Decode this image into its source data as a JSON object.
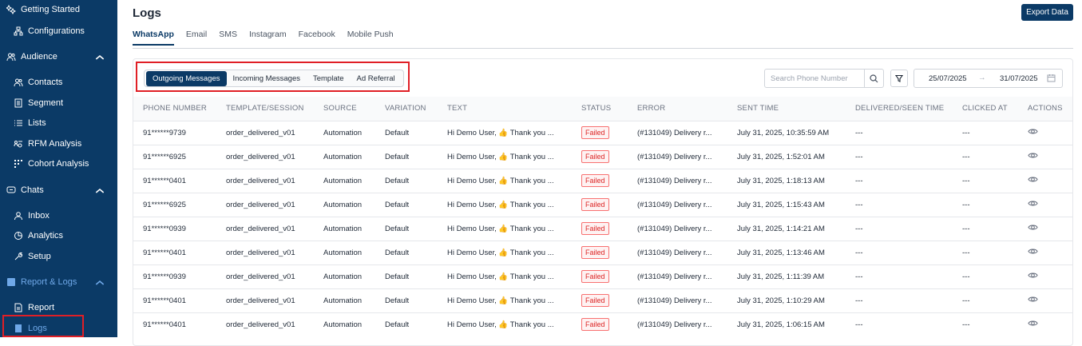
{
  "sidebar": {
    "items": [
      {
        "label": "Getting Started",
        "icon": "sparkle-icon",
        "type": "section"
      },
      {
        "label": "Configurations",
        "icon": "sitemap-icon",
        "type": "item"
      },
      {
        "label": "Audience",
        "icon": "users-icon",
        "type": "section"
      },
      {
        "label": "Contacts",
        "icon": "users-icon",
        "type": "item"
      },
      {
        "label": "Segment",
        "icon": "document-icon",
        "type": "item"
      },
      {
        "label": "Lists",
        "icon": "list-icon",
        "type": "item"
      },
      {
        "label": "RFM Analysis",
        "icon": "rfm-icon",
        "type": "item"
      },
      {
        "label": "Cohort Analysis",
        "icon": "grid-icon",
        "type": "item"
      },
      {
        "label": "Chats",
        "icon": "chat-icon",
        "type": "section"
      },
      {
        "label": "Inbox",
        "icon": "user-icon",
        "type": "item"
      },
      {
        "label": "Analytics",
        "icon": "pie-icon",
        "type": "item"
      },
      {
        "label": "Setup",
        "icon": "wrench-icon",
        "type": "item"
      },
      {
        "label": "Report & Logs",
        "icon": "report-icon",
        "type": "section"
      },
      {
        "label": "Report",
        "icon": "file-icon",
        "type": "item"
      },
      {
        "label": "Logs",
        "icon": "logs-icon",
        "type": "item"
      }
    ]
  },
  "header": {
    "title": "Logs",
    "export_label": "Export Data"
  },
  "tabs": [
    "WhatsApp",
    "Email",
    "SMS",
    "Instagram",
    "Facebook",
    "Mobile Push"
  ],
  "segments": [
    "Outgoing Messages",
    "Incoming Messages",
    "Template",
    "Ad Referral"
  ],
  "search": {
    "placeholder": "Search Phone Number"
  },
  "date_range": {
    "start": "25/07/2025",
    "end": "31/07/2025"
  },
  "colors": {
    "brand": "#0b3a66",
    "failed": "#dc2626",
    "highlight": "#e01f26"
  },
  "table": {
    "columns": [
      "PHONE NUMBER",
      "TEMPLATE/SESSION",
      "SOURCE",
      "VARIATION",
      "TEXT",
      "STATUS",
      "ERROR",
      "SENT TIME",
      "DELIVERED/SEEN TIME",
      "CLICKED AT",
      "ACTIONS"
    ],
    "rows": [
      {
        "phone": "91******9739",
        "template": "order_delivered_v01",
        "source": "Automation",
        "variation": "Default",
        "text": "Hi Demo User, 👍 Thank you ...",
        "status": "Failed",
        "error": "(#131049) Delivery r...",
        "sent": "July 31, 2025, 10:35:59 AM",
        "delivered": "---",
        "clicked": "---"
      },
      {
        "phone": "91******6925",
        "template": "order_delivered_v01",
        "source": "Automation",
        "variation": "Default",
        "text": "Hi Demo User, 👍 Thank you ...",
        "status": "Failed",
        "error": "(#131049) Delivery r...",
        "sent": "July 31, 2025, 1:52:01 AM",
        "delivered": "---",
        "clicked": "---"
      },
      {
        "phone": "91******0401",
        "template": "order_delivered_v01",
        "source": "Automation",
        "variation": "Default",
        "text": "Hi Demo User, 👍 Thank you ...",
        "status": "Failed",
        "error": "(#131049) Delivery r...",
        "sent": "July 31, 2025, 1:18:13 AM",
        "delivered": "---",
        "clicked": "---"
      },
      {
        "phone": "91******6925",
        "template": "order_delivered_v01",
        "source": "Automation",
        "variation": "Default",
        "text": "Hi Demo User, 👍 Thank you ...",
        "status": "Failed",
        "error": "(#131049) Delivery r...",
        "sent": "July 31, 2025, 1:15:43 AM",
        "delivered": "---",
        "clicked": "---"
      },
      {
        "phone": "91******0939",
        "template": "order_delivered_v01",
        "source": "Automation",
        "variation": "Default",
        "text": "Hi Demo User, 👍 Thank you ...",
        "status": "Failed",
        "error": "(#131049) Delivery r...",
        "sent": "July 31, 2025, 1:14:21 AM",
        "delivered": "---",
        "clicked": "---"
      },
      {
        "phone": "91******0401",
        "template": "order_delivered_v01",
        "source": "Automation",
        "variation": "Default",
        "text": "Hi Demo User, 👍 Thank you ...",
        "status": "Failed",
        "error": "(#131049) Delivery r...",
        "sent": "July 31, 2025, 1:13:46 AM",
        "delivered": "---",
        "clicked": "---"
      },
      {
        "phone": "91******0939",
        "template": "order_delivered_v01",
        "source": "Automation",
        "variation": "Default",
        "text": "Hi Demo User, 👍 Thank you ...",
        "status": "Failed",
        "error": "(#131049) Delivery r...",
        "sent": "July 31, 2025, 1:11:39 AM",
        "delivered": "---",
        "clicked": "---"
      },
      {
        "phone": "91******0401",
        "template": "order_delivered_v01",
        "source": "Automation",
        "variation": "Default",
        "text": "Hi Demo User, 👍 Thank you ...",
        "status": "Failed",
        "error": "(#131049) Delivery r...",
        "sent": "July 31, 2025, 1:10:29 AM",
        "delivered": "---",
        "clicked": "---"
      },
      {
        "phone": "91******0401",
        "template": "order_delivered_v01",
        "source": "Automation",
        "variation": "Default",
        "text": "Hi Demo User, 👍 Thank you ...",
        "status": "Failed",
        "error": "(#131049) Delivery r...",
        "sent": "July 31, 2025, 1:06:15 AM",
        "delivered": "---",
        "clicked": "---"
      }
    ]
  }
}
